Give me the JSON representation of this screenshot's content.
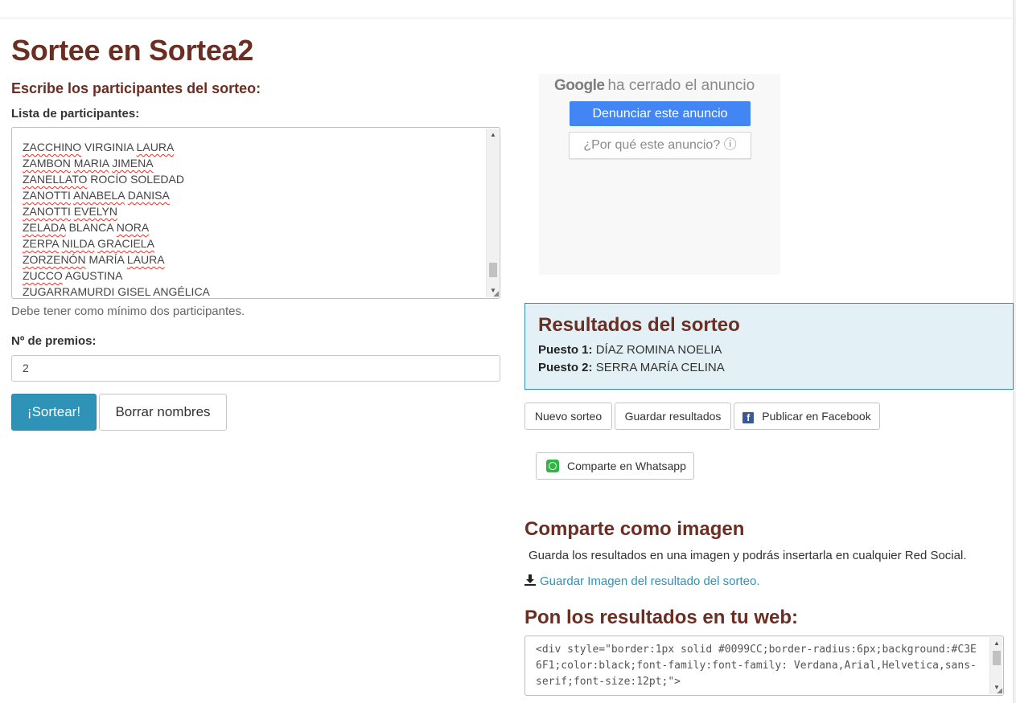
{
  "page": {
    "title": "Sortee en Sortea2",
    "subtitle": "Escribe los participantes del sorteo:"
  },
  "participants": {
    "label": "Lista de participantes:",
    "lines": [
      [
        {
          "t": "ZACCHINO",
          "sq": true
        },
        {
          "t": " VIRGINIA ",
          "sq": false
        },
        {
          "t": "LAURA",
          "sq": true
        }
      ],
      [
        {
          "t": "ZAMBON",
          "sq": true
        },
        {
          "t": " ",
          "sq": false
        },
        {
          "t": "MARIA",
          "sq": true
        },
        {
          "t": " ",
          "sq": false
        },
        {
          "t": "JIMENA",
          "sq": true
        }
      ],
      [
        {
          "t": "ZANELLATO",
          "sq": true
        },
        {
          "t": " ROCÍO SOLEDAD",
          "sq": false
        }
      ],
      [
        {
          "t": "ZANOTTI",
          "sq": true
        },
        {
          "t": " ",
          "sq": false
        },
        {
          "t": "ANABELA",
          "sq": true
        },
        {
          "t": " ",
          "sq": false
        },
        {
          "t": "DANISA",
          "sq": true
        }
      ],
      [
        {
          "t": "ZANOTTI",
          "sq": true
        },
        {
          "t": " ",
          "sq": false
        },
        {
          "t": "EVELYN",
          "sq": true
        }
      ],
      [
        {
          "t": "ZELADA",
          "sq": true
        },
        {
          "t": " BLANCA ",
          "sq": false
        },
        {
          "t": "NORA",
          "sq": true
        }
      ],
      [
        {
          "t": "ZERPA",
          "sq": true
        },
        {
          "t": " ",
          "sq": false
        },
        {
          "t": "NILDA",
          "sq": true
        },
        {
          "t": " ",
          "sq": false
        },
        {
          "t": "GRACIELA",
          "sq": true
        }
      ],
      [
        {
          "t": "ZORZENÓN",
          "sq": true
        },
        {
          "t": " MARÍA ",
          "sq": false
        },
        {
          "t": "LAURA",
          "sq": true
        }
      ],
      [
        {
          "t": "ZUCCO",
          "sq": true
        },
        {
          "t": " AGUSTINA",
          "sq": false
        }
      ],
      [
        {
          "t": "ZUGARRAMURDI",
          "sq": true
        },
        {
          "t": " ",
          "sq": false
        },
        {
          "t": "GISEL",
          "sq": true
        },
        {
          "t": " ANGÉLICA",
          "sq": false
        }
      ]
    ],
    "scroll_position": 0.93,
    "help_text": "Debe tener como mínimo dos participantes."
  },
  "prizes": {
    "label": "Nº de premios:",
    "value": "2"
  },
  "buttons": {
    "draw": "¡Sortear!",
    "clear": "Borrar nombres"
  },
  "ad": {
    "google": "Google",
    "closed_text": "ha cerrado el anuncio",
    "report": "Denunciar este anuncio",
    "why": "¿Por qué este anuncio? ⓘ"
  },
  "results": {
    "title": "Resultados del sorteo",
    "items": [
      {
        "label": "Puesto 1:",
        "name": "DÍAZ ROMINA NOELIA"
      },
      {
        "label": "Puesto 2:",
        "name": "SERRA MARÍA CELINA"
      }
    ]
  },
  "actions": {
    "new_draw": "Nuevo sorteo",
    "save_results": "Guardar resultados",
    "facebook": "Publicar en Facebook",
    "whatsapp": "Comparte en Whatsapp"
  },
  "share_image": {
    "title": "Comparte como imagen",
    "text": "Guarda los resultados en una imagen y podrás insertarla en cualquier Red Social.",
    "link": "Guardar Imagen del resultado del sorteo."
  },
  "embed": {
    "title": "Pon los resultados en tu web:",
    "code": "<div style=\"border:1px solid #0099CC;border-radius:6px;background:#C3E6F1;color:black;font-family:font-family: Verdana,Arial,Helvetica,sans-serif;font-size:12pt;\">"
  },
  "colors": {
    "heading": "#6b2e22",
    "primary": "#2e93b6",
    "results_bg": "#e3f1f6",
    "results_border": "#2f8fb4",
    "google_blue": "#4285f4"
  }
}
